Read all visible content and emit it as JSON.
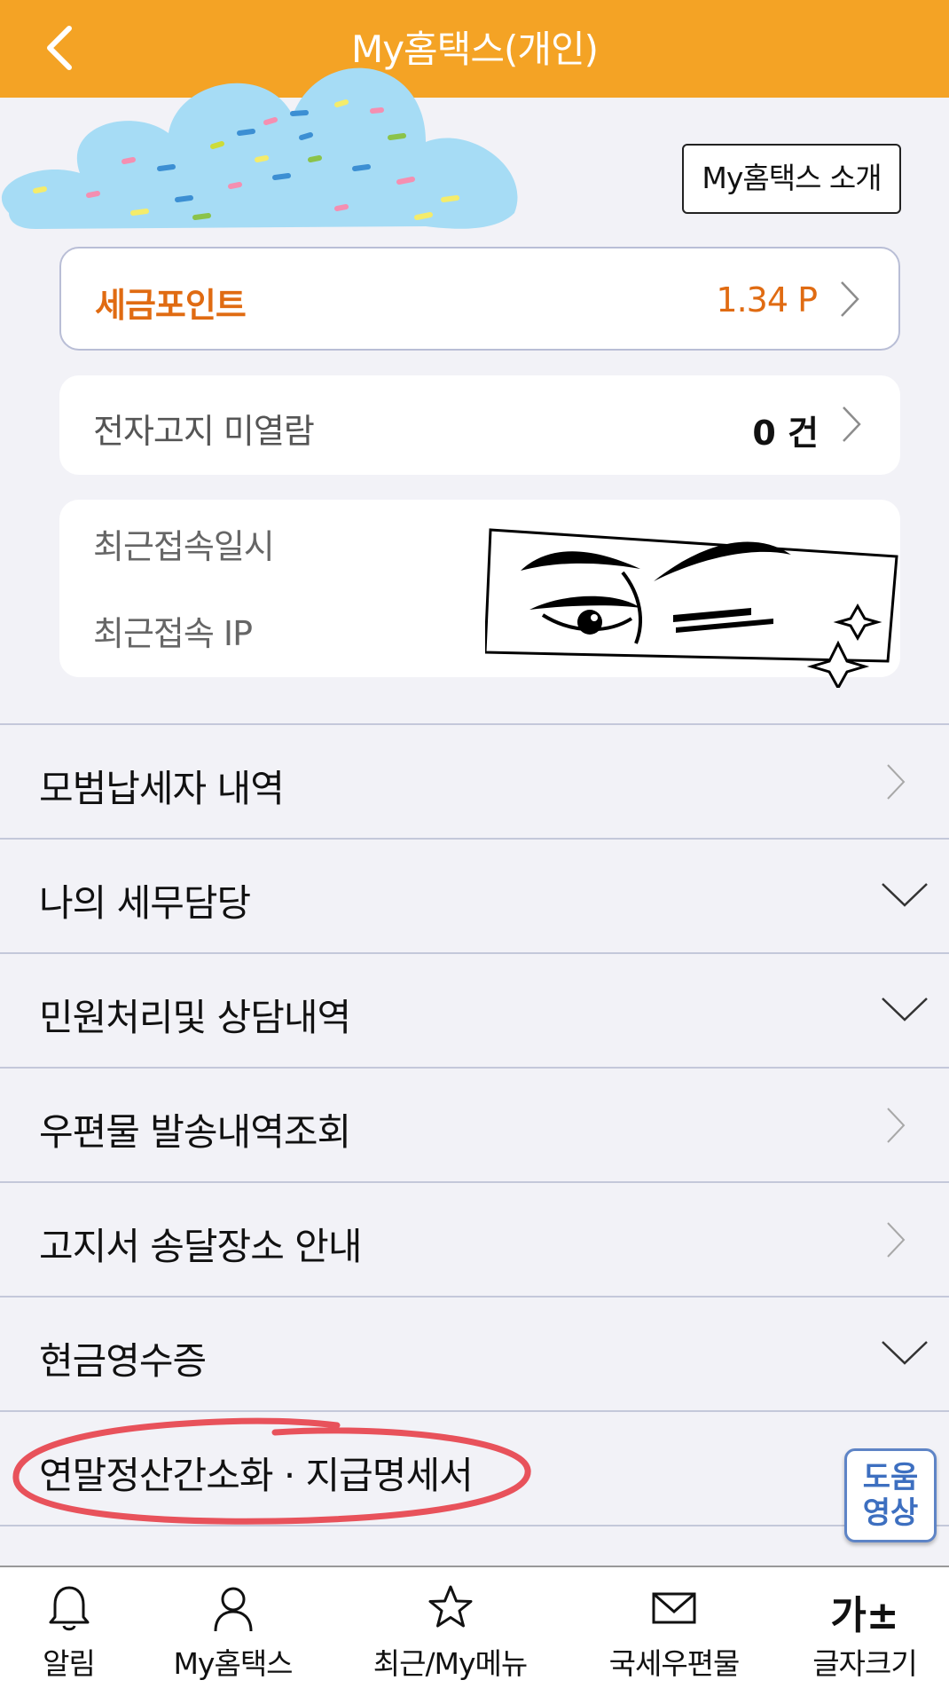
{
  "header": {
    "title": "My홈택스(개인)"
  },
  "intro_button": "My홈택스 소개",
  "points": {
    "label": "세금포인트",
    "value": "1.34 P"
  },
  "notice": {
    "label": "전자고지 미열람",
    "value": "0 건"
  },
  "access": {
    "date_label": "최근접속일시",
    "ip_label": "최근접속 IP"
  },
  "menu": [
    {
      "label": "모범납세자 내역",
      "chevron": "chevron-right"
    },
    {
      "label": "나의 세무담당",
      "chevron": "chevron-down"
    },
    {
      "label": "민원처리및 상담내역",
      "chevron": "chevron-down"
    },
    {
      "label": "우편물 발송내역조회",
      "chevron": "chevron-right"
    },
    {
      "label": "고지서 송달장소 안내",
      "chevron": "chevron-right"
    },
    {
      "label": "현금영수증",
      "chevron": "chevron-down"
    },
    {
      "label": "연말정산간소화 · 지급명세서",
      "chevron": "chevron-down"
    }
  ],
  "help_button": "도움\n영상",
  "bottom_nav": [
    {
      "label": "알림",
      "icon": "bell-icon"
    },
    {
      "label": "My홈택스",
      "icon": "person-icon"
    },
    {
      "label": "최근/My메뉴",
      "icon": "star-icon"
    },
    {
      "label": "국세우편물",
      "icon": "envelope-icon"
    },
    {
      "label": "글자크기",
      "icon": "font-size-icon",
      "icon_text": "가±"
    }
  ],
  "colors": {
    "header": "#f4a325",
    "points_accent": "#e06b12",
    "help_border": "#5e84c6",
    "red_annotation": "#e8525b"
  }
}
